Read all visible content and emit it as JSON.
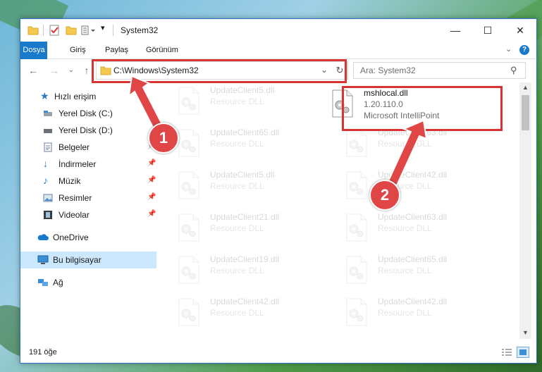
{
  "window": {
    "title": "System32",
    "controls": {
      "minimize_icon": "minimize-icon",
      "maximize_icon": "maximize-icon",
      "close_icon": "close-icon"
    }
  },
  "ribbon": {
    "tabs": [
      {
        "label": "Dosya"
      },
      {
        "label": "Giriş"
      },
      {
        "label": "Paylaş"
      },
      {
        "label": "Görünüm"
      }
    ]
  },
  "navigation": {
    "address": "C:\\Windows\\System32",
    "search_placeholder": "Ara: System32"
  },
  "sidebar": {
    "items": [
      {
        "label": "Hızlı erişim",
        "icon": "star-icon"
      },
      {
        "label": "Yerel Disk (C:)",
        "icon": "drive-icon"
      },
      {
        "label": "Yerel Disk (D:)",
        "icon": "drive-icon"
      },
      {
        "label": "Belgeler",
        "icon": "documents-icon"
      },
      {
        "label": "İndirmeler",
        "icon": "download-icon"
      },
      {
        "label": "Müzik",
        "icon": "music-icon"
      },
      {
        "label": "Resimler",
        "icon": "pictures-icon"
      },
      {
        "label": "Videolar",
        "icon": "videos-icon"
      },
      {
        "label": "OneDrive",
        "icon": "cloud-icon"
      },
      {
        "label": "Bu bilgisayar",
        "icon": "computer-icon"
      },
      {
        "label": "Ağ",
        "icon": "network-icon"
      }
    ]
  },
  "files": {
    "highlighted": {
      "name": "mshlocal.dll",
      "version": "1.20.110.0",
      "type": "Microsoft IntelliPoint"
    },
    "left_column": [
      {
        "name": "UpdateClient5.dll",
        "type": "Resource DLL"
      },
      {
        "name": "UpdateClient65.dll",
        "type": "Resource DLL"
      },
      {
        "name": "UpdateClient5.dll",
        "type": "Resource DLL"
      },
      {
        "name": "UpdateClient21.dll",
        "type": "Resource DLL"
      },
      {
        "name": "UpdateClient19.dll",
        "type": "Resource DLL"
      },
      {
        "name": "UpdateClient42.dll",
        "type": "Resource DLL"
      }
    ],
    "right_column": [
      {
        "name": "UpdateClient63.dll",
        "type": "Resource DLL"
      },
      {
        "name": "UpdateClient42.dll",
        "type": "Resource DLL"
      },
      {
        "name": "UpdateClient63.dll",
        "type": "Resource DLL"
      },
      {
        "name": "UpdateClient65.dll",
        "type": "Resource DLL"
      },
      {
        "name": "UpdateClient42.dll",
        "type": "Resource DLL"
      }
    ]
  },
  "status": {
    "item_count": "191 öğe"
  },
  "annotations": {
    "badge1": "1",
    "badge2": "2",
    "accent": "#d93434"
  }
}
